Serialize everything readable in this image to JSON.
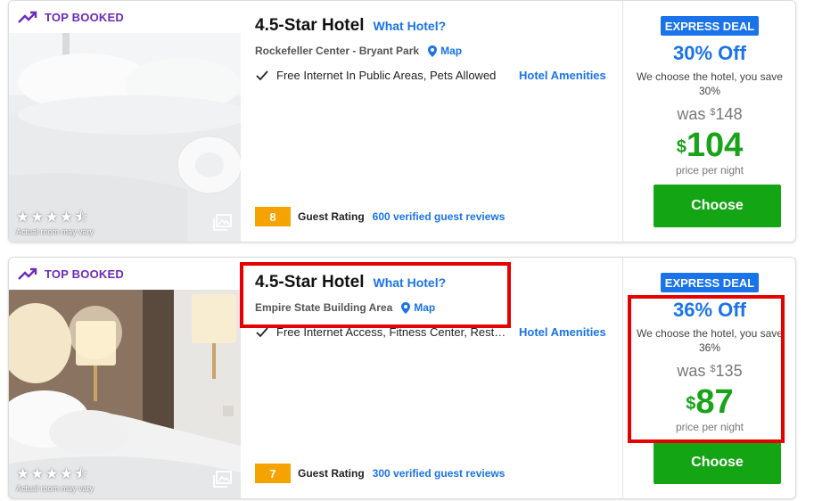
{
  "icons": {
    "trend": "trending-up-icon",
    "gallery": "image-gallery-icon",
    "map": "map-pin-icon",
    "check": "check-icon",
    "star": "star-icon"
  },
  "colors": {
    "accent_blue": "#1a73e8",
    "top_booked_purple": "#6b2bb8",
    "price_green": "#19a319",
    "button_green": "#14a514",
    "rating_orange": "#f5a300",
    "highlight_red": "#e60000"
  },
  "listings": [
    {
      "badge": "TOP BOOKED",
      "star_rating": 4.5,
      "room_note": "Actual room may vary",
      "title": "4.5-Star Hotel",
      "what_hotel": "What Hotel?",
      "area": "Rockefeller Center - Bryant Park",
      "map_label": "Map",
      "amenities": "Free Internet In Public Areas, Pets Allowed",
      "amenities_link": "Hotel Amenities",
      "rating_score": "8",
      "guest_rating_label": "Guest Rating",
      "reviews": "600 verified guest reviews",
      "deal_badge": "EXPRESS DEAL",
      "discount": "30% Off",
      "choose_note": "We choose the hotel, you save 30%",
      "was_label": "was",
      "currency": "$",
      "was_price": "148",
      "price": "104",
      "per_night": "price per night",
      "choose_label": "Choose"
    },
    {
      "badge": "TOP BOOKED",
      "star_rating": 4.5,
      "room_note": "Actual room may vary",
      "title": "4.5-Star Hotel",
      "what_hotel": "What Hotel?",
      "area": "Empire State Building Area",
      "map_label": "Map",
      "amenities": "Free Internet Access, Fitness Center, Restaurant",
      "amenities_link": "Hotel Amenities",
      "rating_score": "7",
      "guest_rating_label": "Guest Rating",
      "reviews": "300 verified guest reviews",
      "deal_badge": "EXPRESS DEAL",
      "discount": "36% Off",
      "choose_note": "We choose the hotel, you save 36%",
      "was_label": "was",
      "currency": "$",
      "was_price": "135",
      "price": "87",
      "per_night": "price per night",
      "choose_label": "Choose"
    }
  ]
}
